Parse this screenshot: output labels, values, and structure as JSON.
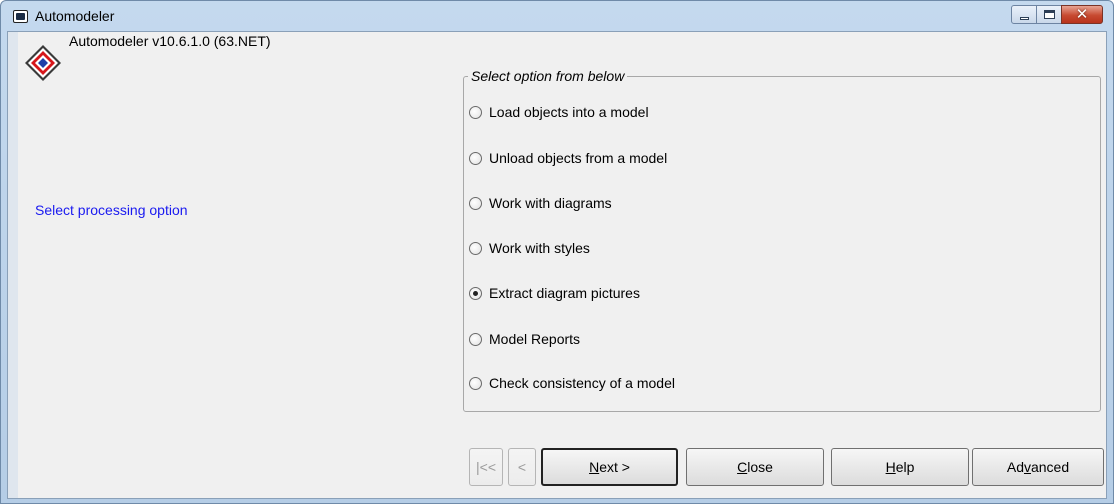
{
  "window": {
    "title": "Automodeler"
  },
  "header": {
    "version": "Automodeler v10.6.1.0 (63.NET)"
  },
  "hint": "Select processing option",
  "options": {
    "legend": "Select option from below",
    "items": [
      {
        "label": "Load objects into a model",
        "checked": false
      },
      {
        "label": "Unload objects from a model",
        "checked": false
      },
      {
        "label": "Work with diagrams",
        "checked": false
      },
      {
        "label": "Work with styles",
        "checked": false
      },
      {
        "label": "Extract diagram pictures",
        "checked": true
      },
      {
        "label": "Model Reports",
        "checked": false
      },
      {
        "label": "Check consistency of a model",
        "checked": false
      }
    ]
  },
  "buttons": {
    "first": "|<<",
    "prev": "<",
    "next": "Next >",
    "close": "Close",
    "help": "Help",
    "advanced": "Advanced"
  },
  "icons": {
    "app": "app-window-icon",
    "logo": "diamond-logo-icon",
    "minimize": "minimize-icon",
    "maximize": "maximize-icon",
    "close": "close-icon"
  },
  "colors": {
    "hint": "#1a1af0",
    "close_button": "#c74a31"
  }
}
